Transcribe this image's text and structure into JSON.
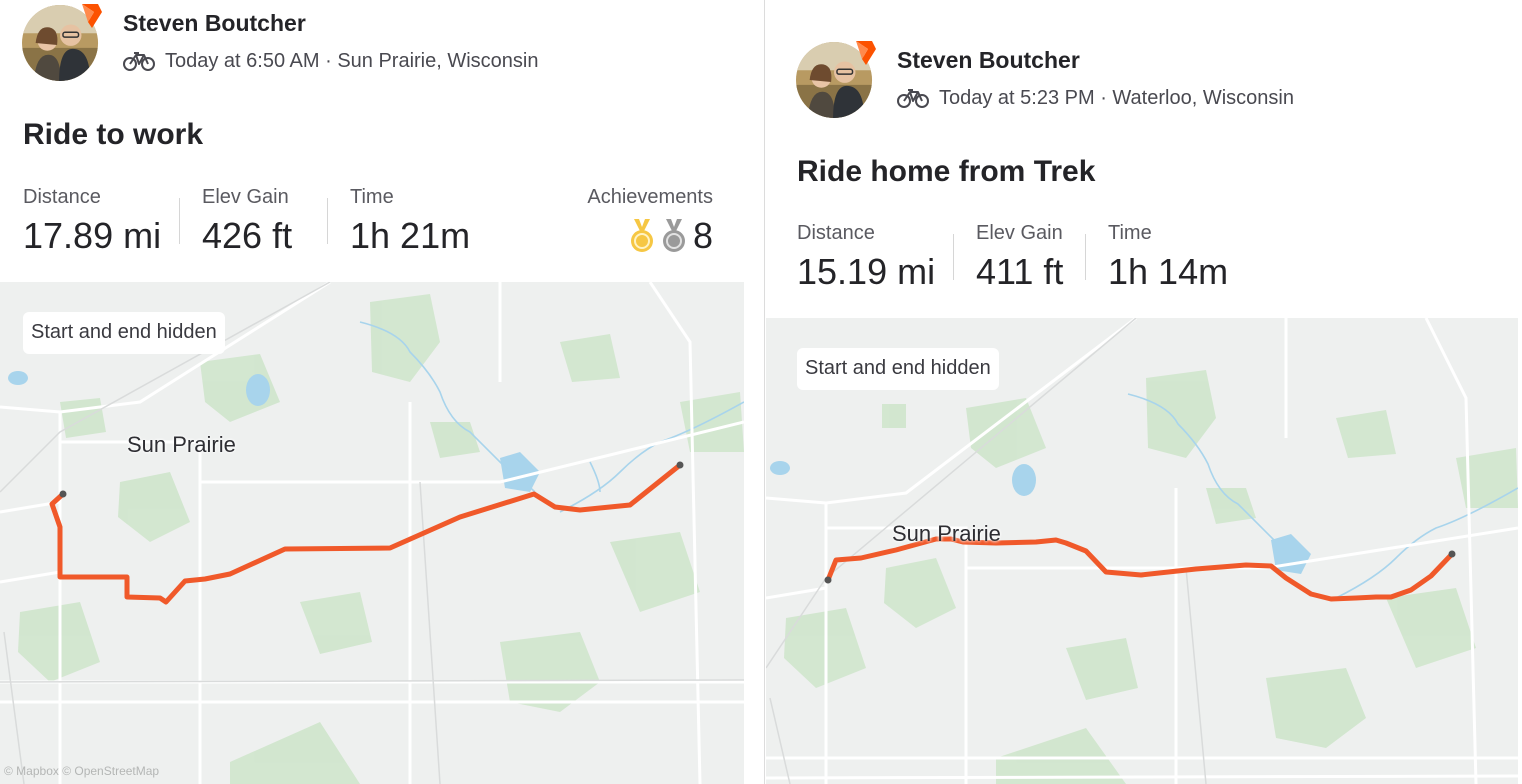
{
  "activities": [
    {
      "athlete": {
        "name": "Steven Boutcher"
      },
      "sport_icon": "bike-icon",
      "meta": "Today at 6:50 AM · Sun Prairie, Wisconsin",
      "title": "Ride to work",
      "stats": {
        "distance": {
          "label": "Distance",
          "value": "17.89 mi"
        },
        "elev_gain": {
          "label": "Elev Gain",
          "value": "426 ft"
        },
        "time": {
          "label": "Time",
          "value": "1h 21m"
        }
      },
      "achievements": {
        "label": "Achievements",
        "medals": [
          "gold-medal-icon",
          "silver-medal-icon"
        ],
        "count": "8"
      },
      "map": {
        "privacy_badge": "Start and end hidden",
        "town": "Sun Prairie",
        "attribution": "© Mapbox © OpenStreetMap"
      }
    },
    {
      "athlete": {
        "name": "Steven Boutcher"
      },
      "sport_icon": "bike-icon",
      "meta": "Today at 5:23 PM · Waterloo, Wisconsin",
      "title": "Ride home from Trek",
      "stats": {
        "distance": {
          "label": "Distance",
          "value": "15.19 mi"
        },
        "elev_gain": {
          "label": "Elev Gain",
          "value": "411 ft"
        },
        "time": {
          "label": "Time",
          "value": "1h 14m"
        }
      },
      "map": {
        "privacy_badge": "Start and end hidden",
        "town": "Sun Prairie"
      }
    }
  ],
  "colors": {
    "route": "#f0592a",
    "brand": "#fc5200",
    "map_bg": "#eef0ef",
    "map_green": "#cfe6cc",
    "map_water": "#a8d4ec",
    "gold": "#f6c744",
    "silver": "#9a9a9a"
  }
}
